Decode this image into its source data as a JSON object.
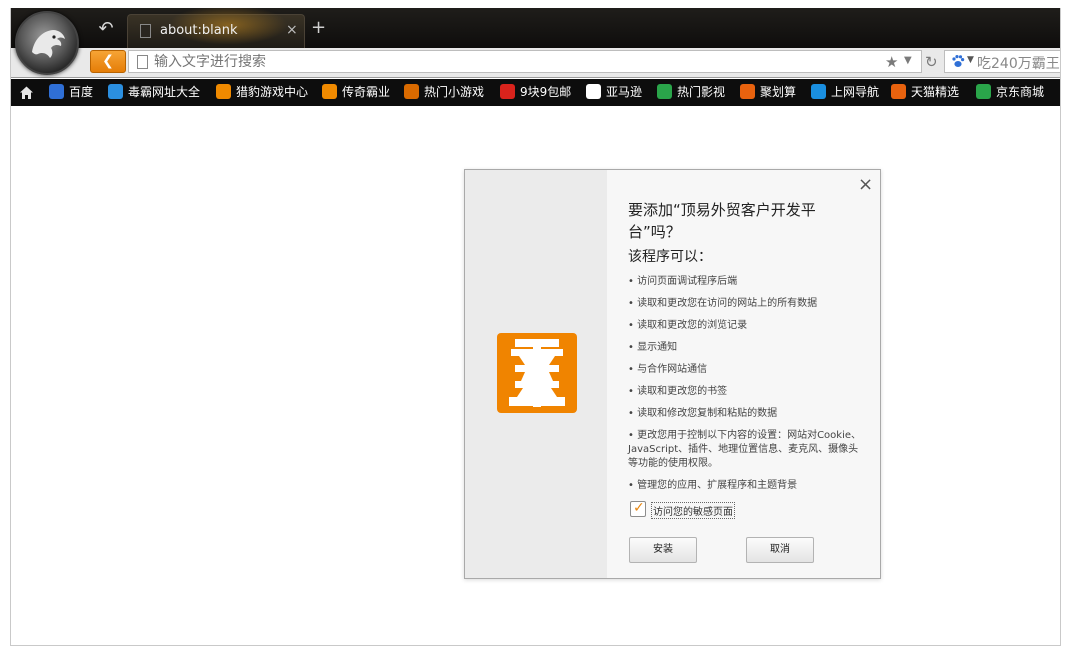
{
  "tab": {
    "title": "about:blank",
    "close": "×",
    "new_tab": "+"
  },
  "address": {
    "placeholder": "输入文字进行搜索",
    "search_text": "吃240万霸王"
  },
  "bookmarks": [
    {
      "label": "百度",
      "icon": "baidu-icon",
      "color": "#2f6fd6"
    },
    {
      "label": "毒霸网址大全",
      "icon": "duba-icon",
      "color": "#2b8fe0"
    },
    {
      "label": "猎豹游戏中心",
      "icon": "liebao-game-icon",
      "color": "#f08a00"
    },
    {
      "label": "传奇霸业",
      "icon": "chuanqi-icon",
      "color": "#f08a00"
    },
    {
      "label": "热门小游戏",
      "icon": "game-icon",
      "color": "#d96a00"
    },
    {
      "label": "9块9包邮",
      "icon": "gou-icon",
      "color": "#d9231c"
    },
    {
      "label": "亚马逊",
      "icon": "amazon-icon",
      "color": "#ffffff"
    },
    {
      "label": "热门影视",
      "icon": "video-icon",
      "color": "#2aa54a"
    },
    {
      "label": "聚划算",
      "icon": "taobao-icon",
      "color": "#e8620e"
    },
    {
      "label": "上网导航",
      "icon": "ie-icon",
      "color": "#1a8fe0"
    },
    {
      "label": "天猫精选",
      "icon": "tmall-icon",
      "color": "#e8620e"
    },
    {
      "label": "京东商城",
      "icon": "jd-icon",
      "color": "#2aa54a"
    }
  ],
  "dialog": {
    "title": "要添加“顶易外贸客户开发平台”吗？",
    "subtitle": "该程序可以：",
    "permissions": [
      "• 访问页面调试程序后端",
      "• 读取和更改您在访问的网站上的所有数据",
      "• 读取和更改您的浏览记录",
      "• 显示通知",
      "• 与合作网站通信",
      "• 读取和更改您的书签",
      "• 读取和修改您复制和粘贴的数据",
      "• 更改您用于控制以下内容的设置：网站对Cookie、JavaScript、插件、地理位置信息、麦克风、摄像头等功能的使用权限。",
      "• 管理您的应用、扩展程序和主题背景"
    ],
    "checkbox_label": "访问您的敏感页面",
    "checkbox_checked": true,
    "install_label": "安装",
    "cancel_label": "取消",
    "close": "×",
    "accent": "#f08400"
  }
}
